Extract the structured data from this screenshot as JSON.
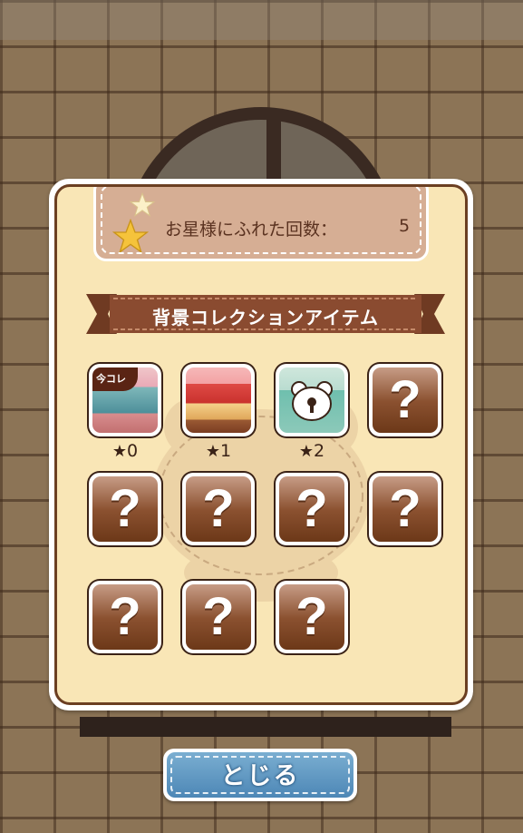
{
  "stats": {
    "label": "お星様にふれた回数：",
    "value": "5"
  },
  "section": {
    "title": "背景コレクションアイテム"
  },
  "items": [
    {
      "name": "item-1",
      "unlocked": true,
      "badge": "今コレ",
      "stars": "0",
      "thumb": "room-pink"
    },
    {
      "name": "item-2",
      "unlocked": true,
      "badge": "",
      "stars": "1",
      "thumb": "strawberry-cake"
    },
    {
      "name": "item-3",
      "unlocked": true,
      "badge": "",
      "stars": "2",
      "thumb": "locked-room-bear"
    },
    {
      "name": "item-4",
      "unlocked": false,
      "mystery": "?"
    },
    {
      "name": "item-5",
      "unlocked": false,
      "mystery": "?"
    },
    {
      "name": "item-6",
      "unlocked": false,
      "mystery": "?"
    },
    {
      "name": "item-7",
      "unlocked": false,
      "mystery": "?"
    },
    {
      "name": "item-8",
      "unlocked": false,
      "mystery": "?"
    },
    {
      "name": "item-9",
      "unlocked": false,
      "mystery": "?"
    },
    {
      "name": "item-10",
      "unlocked": false,
      "mystery": "?"
    },
    {
      "name": "item-11",
      "unlocked": false,
      "mystery": "?"
    }
  ],
  "star_symbol": "★",
  "close_button": {
    "label": "とじる"
  },
  "colors": {
    "panel": "#f9e6b6",
    "panel_border": "#6b3f22",
    "ribbon": "#8a4b30",
    "tile": "#8b5130",
    "button": "#4d87b6"
  }
}
